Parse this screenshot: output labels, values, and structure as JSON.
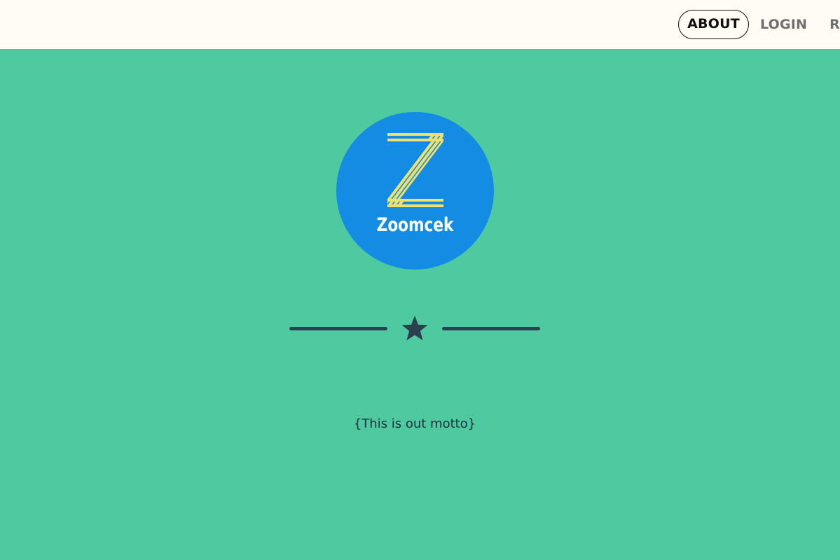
{
  "nav": {
    "items": [
      {
        "label": "ABOUT",
        "active": true
      },
      {
        "label": "LOGIN",
        "active": false
      },
      {
        "label": "RE",
        "active": false
      }
    ]
  },
  "logo": {
    "text": "Zoomcek",
    "circle_color": "#138de3",
    "stripe_color": "#f1e06a"
  },
  "divider": {
    "icon": "star-icon",
    "color": "#2c3e50"
  },
  "motto": "{This is out motto}",
  "colors": {
    "background": "#4fc9a0",
    "topbar": "#fffcf4",
    "text": "#1f2f3d"
  }
}
